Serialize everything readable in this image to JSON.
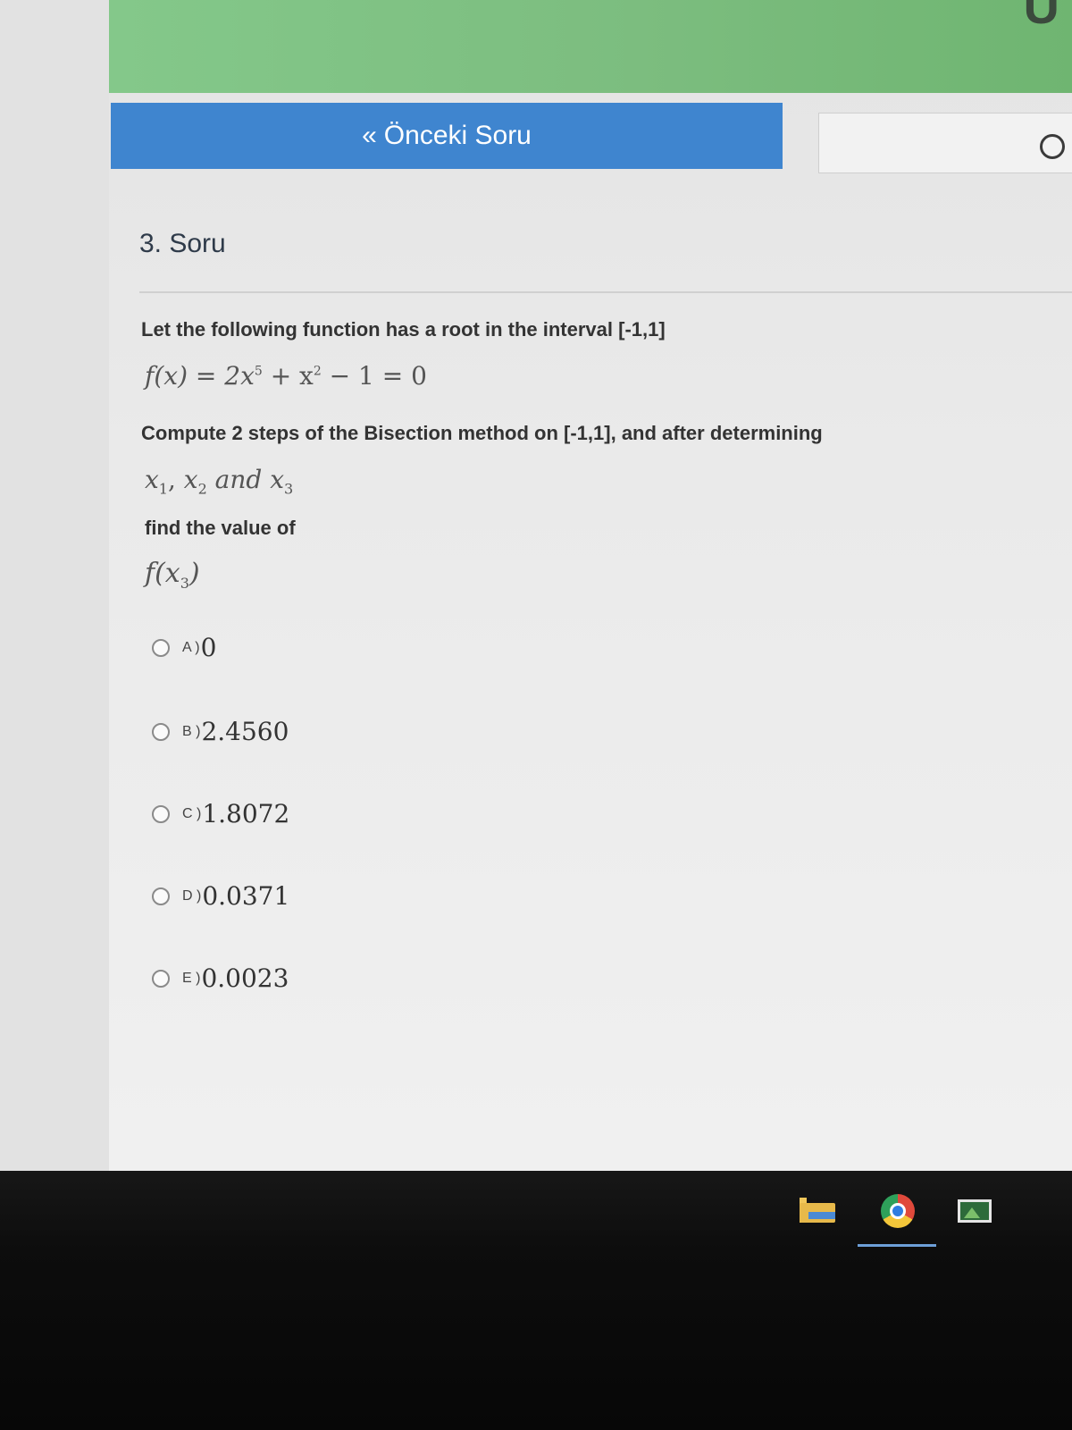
{
  "nav": {
    "prev_chevron": "«",
    "prev_label": "Önceki Soru"
  },
  "question": {
    "number": "3. Soru",
    "intro": "Let the following function has a root in the interval [-1,1]",
    "equation": {
      "lhs": "f(x) = 2x",
      "exp1": "5",
      "mid": " + x",
      "exp2": "2",
      "rhs": " − 1 = 0"
    },
    "instruction": "Compute 2 steps of the Bisection method on [-1,1], and after determining",
    "vars": {
      "x": "x",
      "s1": "1",
      "sep": ", ",
      "s2": "2",
      "and": " and ",
      "s3": "3"
    },
    "find": "find the value of",
    "target": {
      "open": "f(x",
      "sub": "3",
      "close": ")"
    }
  },
  "options": [
    {
      "letter": "A )",
      "value": "0"
    },
    {
      "letter": "B )",
      "value": "2.4560"
    },
    {
      "letter": "C )",
      "value": "1.8072"
    },
    {
      "letter": "D )",
      "value": "0.0371"
    },
    {
      "letter": "E )",
      "value": "0.0023"
    }
  ],
  "taskbar": {
    "icons": [
      "file-explorer-icon",
      "chrome-icon",
      "image-viewer-icon"
    ]
  },
  "colors": {
    "banner": "#7cbd7f",
    "prev_button": "#3f85cf",
    "taskbar": "#0d0d0d"
  }
}
